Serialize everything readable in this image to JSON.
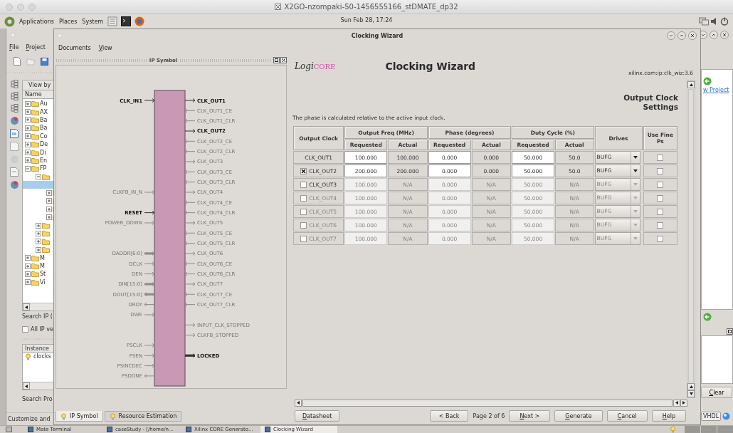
{
  "session": {
    "title": "X2GO-nzompaki-50-1456555166_stDMATE_dp32"
  },
  "top_panel": {
    "menus": [
      "Applications",
      "Places",
      "System"
    ],
    "clock": "Sun Feb 28, 17:24"
  },
  "ise_window": {
    "menus": [
      "File",
      "Project"
    ],
    "view_by": "View by",
    "tree_column": "Name",
    "tree": [
      {
        "kind": "folder",
        "label": "Au",
        "expanded": false,
        "selected": false
      },
      {
        "kind": "folder",
        "label": "AX",
        "expanded": false,
        "selected": false
      },
      {
        "kind": "folder",
        "label": "Ba",
        "expanded": false,
        "selected": false
      },
      {
        "kind": "folder",
        "label": "Ba",
        "expanded": false,
        "selected": false
      },
      {
        "kind": "folder",
        "label": "Co",
        "expanded": false,
        "selected": false
      },
      {
        "kind": "folder",
        "label": "De",
        "expanded": false,
        "selected": false
      },
      {
        "kind": "folder",
        "label": "Di",
        "expanded": false,
        "selected": false
      },
      {
        "kind": "folder",
        "label": "En",
        "expanded": false,
        "selected": false
      },
      {
        "kind": "folder",
        "label": "FP",
        "expanded": true,
        "selected": false,
        "children": [
          {
            "kind": "folder",
            "expanded": true,
            "selected": false,
            "children": [
              {
                "kind": "leaf",
                "selected": true
              },
              {
                "kind": "folder",
                "expanded": false,
                "selected": false
              },
              {
                "kind": "folder",
                "expanded": false,
                "selected": false
              },
              {
                "kind": "folder",
                "expanded": false,
                "selected": false
              },
              {
                "kind": "folder",
                "expanded": false,
                "selected": false
              }
            ]
          },
          {
            "kind": "folder",
            "expanded": false,
            "selected": false
          },
          {
            "kind": "folder",
            "expanded": false,
            "selected": false
          },
          {
            "kind": "folder",
            "expanded": false,
            "selected": false
          },
          {
            "kind": "folder",
            "expanded": false,
            "selected": false
          }
        ]
      },
      {
        "kind": "folder",
        "label": "M",
        "expanded": false,
        "selected": false
      },
      {
        "kind": "folder",
        "label": "M",
        "expanded": false,
        "selected": false
      },
      {
        "kind": "folder",
        "label": "St",
        "expanded": false,
        "selected": false
      },
      {
        "kind": "folder",
        "label": "Vi",
        "expanded": false,
        "selected": false
      }
    ],
    "search_ip": "Search IP (",
    "all_ip": {
      "label": "All IP ve",
      "checked": false
    },
    "instances_column": "Instance",
    "instances": [
      "clocks"
    ],
    "search_project": "Search Pro",
    "status": "Customize and",
    "link": "w Project",
    "clear_button": "Clear",
    "language": "VHDL"
  },
  "wizard": {
    "title": "Clocking Wizard",
    "menus": [
      "Documents",
      "View"
    ],
    "ip_symbol": {
      "title": "IP Symbol",
      "left_pins": [
        {
          "kind": "input",
          "label": "CLK_IN1",
          "active": true,
          "bus": false
        },
        {
          "kind": "gap"
        },
        {
          "kind": "gap"
        },
        {
          "kind": "gap"
        },
        {
          "kind": "gap"
        },
        {
          "kind": "gap"
        },
        {
          "kind": "gap"
        },
        {
          "kind": "gap"
        },
        {
          "kind": "gap"
        },
        {
          "kind": "input",
          "label": "CLKFB_IN_N",
          "active": false,
          "bus": false
        },
        {
          "kind": "gap"
        },
        {
          "kind": "input",
          "label": "RESET",
          "active": true,
          "bus": false
        },
        {
          "kind": "input",
          "label": "POWER_DOWN",
          "active": false,
          "bus": false
        },
        {
          "kind": "gap"
        },
        {
          "kind": "gap"
        },
        {
          "kind": "input",
          "label": "DADDR[6:0]",
          "active": false,
          "bus": true
        },
        {
          "kind": "input",
          "label": "DCLK",
          "active": false,
          "bus": false
        },
        {
          "kind": "input",
          "label": "DEN",
          "active": false,
          "bus": false
        },
        {
          "kind": "input",
          "label": "DIN[15:0]",
          "active": false,
          "bus": true
        },
        {
          "kind": "output",
          "label": "DOUT[15:0]",
          "active": false,
          "bus": true
        },
        {
          "kind": "output",
          "label": "DRDY",
          "active": false,
          "bus": false
        },
        {
          "kind": "input",
          "label": "DWE",
          "active": false,
          "bus": false
        },
        {
          "kind": "gap"
        },
        {
          "kind": "gap"
        },
        {
          "kind": "input",
          "label": "PSCLK",
          "active": false,
          "bus": false
        },
        {
          "kind": "input",
          "label": "PSEN",
          "active": false,
          "bus": false
        },
        {
          "kind": "input",
          "label": "PSINCDEC",
          "active": false,
          "bus": false
        },
        {
          "kind": "output",
          "label": "PSDONE",
          "active": false,
          "bus": false
        }
      ],
      "right_pins": [
        {
          "kind": "output",
          "label": "CLK_OUT1",
          "active": true,
          "bus": false
        },
        {
          "kind": "input",
          "label": "CLK_OUT1_CE",
          "active": false,
          "bus": false
        },
        {
          "kind": "input",
          "label": "CLK_OUT1_CLR",
          "active": false,
          "bus": false
        },
        {
          "kind": "output",
          "label": "CLK_OUT2",
          "active": true,
          "bus": false
        },
        {
          "kind": "input",
          "label": "CLK_OUT2_CE",
          "active": false,
          "bus": false
        },
        {
          "kind": "input",
          "label": "CLK_OUT2_CLR",
          "active": false,
          "bus": false
        },
        {
          "kind": "output",
          "label": "CLK_OUT3",
          "active": false,
          "bus": false
        },
        {
          "kind": "input",
          "label": "CLK_OUT3_CE",
          "active": false,
          "bus": false
        },
        {
          "kind": "input",
          "label": "CLK_OUT3_CLR",
          "active": false,
          "bus": false
        },
        {
          "kind": "output",
          "label": "CLK_OUT4",
          "active": false,
          "bus": false
        },
        {
          "kind": "input",
          "label": "CLK_OUT4_CE",
          "active": false,
          "bus": false
        },
        {
          "kind": "input",
          "label": "CLK_OUT4_CLR",
          "active": false,
          "bus": false
        },
        {
          "kind": "output",
          "label": "CLK_OUT5",
          "active": false,
          "bus": false
        },
        {
          "kind": "input",
          "label": "CLK_OUT5_CE",
          "active": false,
          "bus": false
        },
        {
          "kind": "input",
          "label": "CLK_OUT5_CLR",
          "active": false,
          "bus": false
        },
        {
          "kind": "output",
          "label": "CLK_OUT6",
          "active": false,
          "bus": false
        },
        {
          "kind": "input",
          "label": "CLK_OUT6_CE",
          "active": false,
          "bus": false
        },
        {
          "kind": "input",
          "label": "CLK_OUT6_CLR",
          "active": false,
          "bus": false
        },
        {
          "kind": "output",
          "label": "CLK_OUT7",
          "active": false,
          "bus": false
        },
        {
          "kind": "input",
          "label": "CLK_OUT7_CE",
          "active": false,
          "bus": false
        },
        {
          "kind": "input",
          "label": "CLK_OUT7_CLR",
          "active": false,
          "bus": false
        },
        {
          "kind": "gap"
        },
        {
          "kind": "output",
          "label": "INPUT_CLK_STOPPED",
          "active": false,
          "bus": false
        },
        {
          "kind": "output",
          "label": "CLKFB_STOPPED",
          "active": false,
          "bus": false
        },
        {
          "kind": "gap"
        },
        {
          "kind": "output",
          "label": "LOCKED",
          "active": true,
          "bus": true
        }
      ]
    },
    "tabs": [
      {
        "label": "IP Symbol",
        "selected": true
      },
      {
        "label": "Resource Estimation",
        "selected": false
      }
    ],
    "logo": [
      "Logi",
      "CORE"
    ],
    "heading": "Clocking Wizard",
    "ip_id": "xilinx.com:ip:clk_wiz:3.6",
    "section_title": "Output Clock Settings",
    "note": "The phase is calculated relative to the active input clock.",
    "table": {
      "columns": [
        {
          "label": "Output Clock"
        },
        {
          "label": "Output Freq (MHz)",
          "sub": [
            "Requested",
            "Actual"
          ]
        },
        {
          "label": "Phase (degrees)",
          "sub": [
            "Requested",
            "Actual"
          ]
        },
        {
          "label": "Duty Cycle (%)",
          "sub": [
            "Requested",
            "Actual"
          ]
        },
        {
          "label": "Drives"
        },
        {
          "label": "Use Fine Ps"
        }
      ],
      "rows": [
        {
          "name": "CLK_OUT1",
          "kind": "fixed",
          "checked": true,
          "disabled": false,
          "freq_requested": "100.000",
          "freq_actual": "100.000",
          "phase_requested": "0.000",
          "phase_actual": "0.000",
          "duty_requested": "50.000",
          "duty_actual": "50.0",
          "drives": "BUFG",
          "fine_ps": false
        },
        {
          "name": "CLK_OUT2",
          "kind": "optional",
          "checked": true,
          "disabled": false,
          "freq_requested": "200.000",
          "freq_actual": "200.000",
          "phase_requested": "0.000",
          "phase_actual": "0.000",
          "duty_requested": "50.000",
          "duty_actual": "50.0",
          "drives": "BUFG",
          "fine_ps": false
        },
        {
          "name": "CLK_OUT3",
          "kind": "optional",
          "checked": false,
          "disabled": false,
          "freq_requested": "100.000",
          "freq_actual": "N/A",
          "phase_requested": "0.000",
          "phase_actual": "N/A",
          "duty_requested": "50.000",
          "duty_actual": "N/A",
          "drives": "BUFG",
          "fine_ps": false
        },
        {
          "name": "CLK_OUT4",
          "kind": "optional",
          "checked": false,
          "disabled": true,
          "freq_requested": "100.000",
          "freq_actual": "N/A",
          "phase_requested": "0.000",
          "phase_actual": "N/A",
          "duty_requested": "50.000",
          "duty_actual": "N/A",
          "drives": "BUFG",
          "fine_ps": false
        },
        {
          "name": "CLK_OUT5",
          "kind": "optional",
          "checked": false,
          "disabled": true,
          "freq_requested": "100.000",
          "freq_actual": "N/A",
          "phase_requested": "0.000",
          "phase_actual": "N/A",
          "duty_requested": "50.000",
          "duty_actual": "N/A",
          "drives": "BUFG",
          "fine_ps": false
        },
        {
          "name": "CLK_OUT6",
          "kind": "optional",
          "checked": false,
          "disabled": true,
          "freq_requested": "100.000",
          "freq_actual": "N/A",
          "phase_requested": "0.000",
          "phase_actual": "N/A",
          "duty_requested": "50.000",
          "duty_actual": "N/A",
          "drives": "BUFG",
          "fine_ps": false
        },
        {
          "name": "CLK_OUT7",
          "kind": "optional",
          "checked": false,
          "disabled": true,
          "freq_requested": "100.000",
          "freq_actual": "N/A",
          "phase_requested": "0.000",
          "phase_actual": "N/A",
          "duty_requested": "50.000",
          "duty_actual": "N/A",
          "drives": "BUFG",
          "fine_ps": false
        }
      ]
    },
    "footer": {
      "datasheet": "Datasheet",
      "back": "< Back",
      "page_indicator": "Page 2 of 6",
      "buttons": [
        "Next >",
        "Generate",
        "Cancel",
        "Help"
      ]
    }
  },
  "taskbar": [
    {
      "label": "Mate Terminal",
      "selected": false
    },
    {
      "label": "caseStudy - [/home/n...",
      "selected": false
    },
    {
      "label": "Xilinx CORE Generato...",
      "selected": false
    },
    {
      "label": "Clocking Wizard",
      "selected": true
    }
  ]
}
